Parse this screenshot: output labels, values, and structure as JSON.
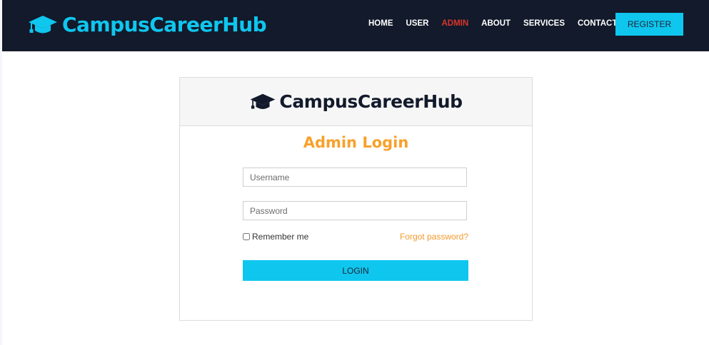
{
  "brand": {
    "name": "CampusCareerHub",
    "icon": "graduation-cap-icon",
    "color": "#0fc6ef"
  },
  "nav": {
    "items": [
      {
        "label": "HOME",
        "active": false
      },
      {
        "label": "USER",
        "active": false
      },
      {
        "label": "ADMIN",
        "active": true
      },
      {
        "label": "ABOUT",
        "active": false
      },
      {
        "label": "SERVICES",
        "active": false
      },
      {
        "label": "CONTACT",
        "active": false
      }
    ],
    "register_label": "REGISTER"
  },
  "login_card": {
    "header_brand": "CampusCareerHub",
    "title": "Admin Login",
    "username_placeholder": "Username",
    "username_value": "",
    "password_placeholder": "Password",
    "password_value": "",
    "remember_label": "Remember me",
    "remember_checked": false,
    "forgot_label": "Forgot password?",
    "login_label": "LOGIN"
  },
  "colors": {
    "navbar_bg": "#121a2b",
    "accent_cyan": "#0fc6ef",
    "accent_orange": "#f7a12b",
    "active_nav": "#d9352b"
  }
}
